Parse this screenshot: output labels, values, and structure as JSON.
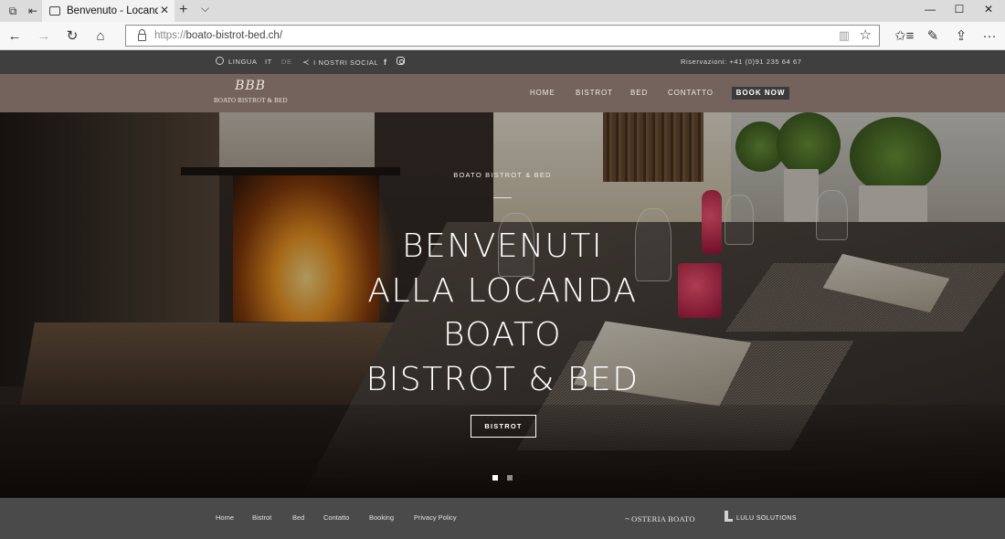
{
  "browser": {
    "tab_title": "Benvenuto - Locanda Bo",
    "tab_close": "✕",
    "new_tab": "+",
    "tabs_menu": "⌵",
    "window_controls": {
      "minimize": "—",
      "maximize": "☐",
      "close": "✕"
    },
    "url_scheme": "https://",
    "url_host": "boato-bistrot-bed.ch/",
    "nav_icons": {
      "back": "←",
      "forward": "→",
      "refresh": "↻",
      "home": "⌂",
      "reading_view": "▥",
      "favorite": "☆",
      "hub": "✩≡",
      "notes": "✎",
      "share": "⇪",
      "more": "···"
    }
  },
  "site": {
    "topbar": {
      "language_label": "LINGUA",
      "lang_it": "IT",
      "lang_de": "DE",
      "social_label": "I NOSTRI SOCIAL",
      "facebook": "f",
      "reservations": "Riservazioni: +41 (0)91 235 64 67"
    },
    "logo": {
      "mark": "BBB",
      "name": "BOATO BISTROT & BED"
    },
    "menu": {
      "home": "HOME",
      "bistrot": "BISTROT",
      "bed": "BED",
      "contatto": "CONTATTO",
      "book_now": "BOOK NOW"
    },
    "hero": {
      "subtitle": "BOATO BISTROT & BED",
      "title_lines": [
        "BENVENUTI",
        "ALLA LOCANDA",
        "BOATO",
        "BISTROT & BED"
      ],
      "button": "BISTROT",
      "slides_total": 2,
      "active_slide": 1
    },
    "footer": {
      "links": {
        "home": "Home",
        "bistrot": "Bistrot",
        "bed": "Bed",
        "contatto": "Contatto",
        "booking": "Booking",
        "privacy": "Privacy Policy"
      },
      "osteria_logo": "OSTERIA BOATO",
      "lulu_logo": "LULU SOLUTIONS"
    }
  },
  "colors": {
    "topbar_bg": "#3f3f3f",
    "header_bg": "#73635c",
    "book_button_bg": "#3b3b3b",
    "footer_bg": "#4a4a4a"
  }
}
